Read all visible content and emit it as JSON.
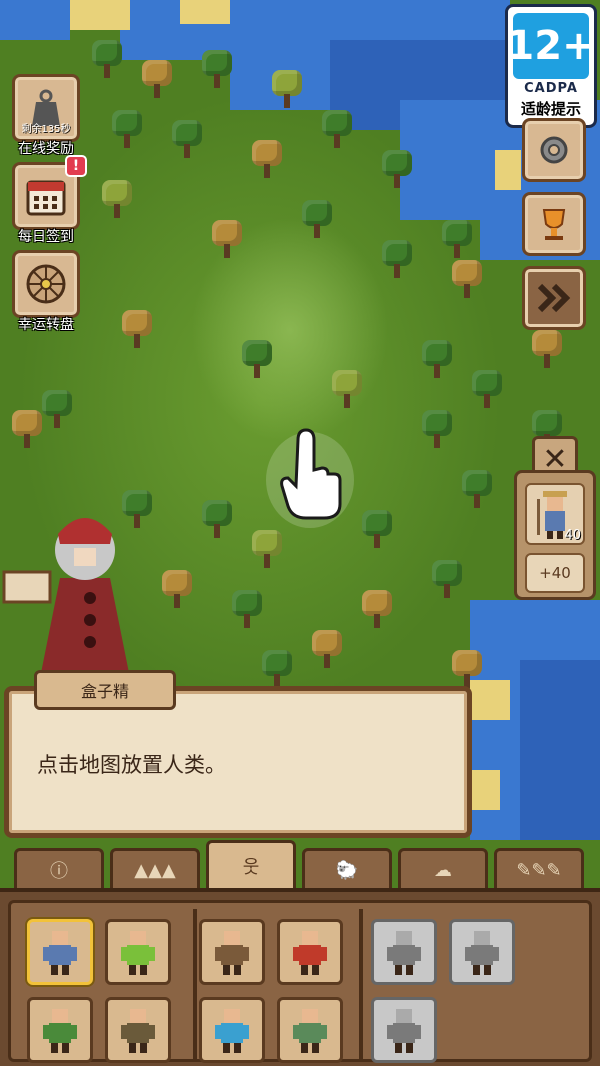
{
  "age_rating": {
    "number": "12+",
    "org": "CADPA",
    "tip": "适龄提示"
  },
  "left_buttons": [
    {
      "label": "在线奖励",
      "icon": "weight-timer-icon",
      "timer_text": "剩余135秒",
      "badge": ""
    },
    {
      "label": "每日签到",
      "icon": "calendar-icon",
      "badge": "!"
    },
    {
      "label": "幸运转盘",
      "icon": "wheel-icon",
      "badge": ""
    }
  ],
  "right_buttons": [
    {
      "icon": "gear-icon"
    },
    {
      "icon": "trophy-icon"
    },
    {
      "icon": "fast-forward-icon"
    }
  ],
  "unit_card": {
    "count": "40",
    "plus_label": "+40"
  },
  "dialog": {
    "speaker": "盒子精",
    "text": "点击地图放置人类。"
  },
  "tabs": [
    {
      "name": "info",
      "icon": "info-icon",
      "glyph": "ⓘ"
    },
    {
      "name": "terrain",
      "icon": "mountains-icon",
      "glyph": "▲▲▲"
    },
    {
      "name": "humanoids",
      "icon": "person-icon",
      "glyph": "웃"
    },
    {
      "name": "animals",
      "icon": "animal-icon",
      "glyph": "🐑"
    },
    {
      "name": "disasters",
      "icon": "clouds-icon",
      "glyph": "☁"
    },
    {
      "name": "tools",
      "icon": "brushes-icon",
      "glyph": "✎✎✎"
    }
  ],
  "units": [
    {
      "name": "human",
      "color": "#5a7ab0",
      "selected": true
    },
    {
      "name": "elf",
      "color": "#7ac03a"
    },
    {
      "name": "scarecrow",
      "color": "#7a5a3a"
    },
    {
      "name": "demon",
      "color": "#c03a2a"
    },
    {
      "name": "snowman",
      "color": "#f0f0f0",
      "locked": true
    },
    {
      "name": "wizard",
      "color": "#a0a0a0",
      "locked": true
    },
    {
      "name": "orc",
      "color": "#4a8a3a"
    },
    {
      "name": "dwarf",
      "color": "#6a5a3a"
    },
    {
      "name": "ice-golem",
      "color": "#3aa0d0"
    },
    {
      "name": "zombie",
      "color": "#5a8a5a"
    },
    {
      "name": "cat",
      "color": "#8a8a8a",
      "locked": true
    }
  ]
}
